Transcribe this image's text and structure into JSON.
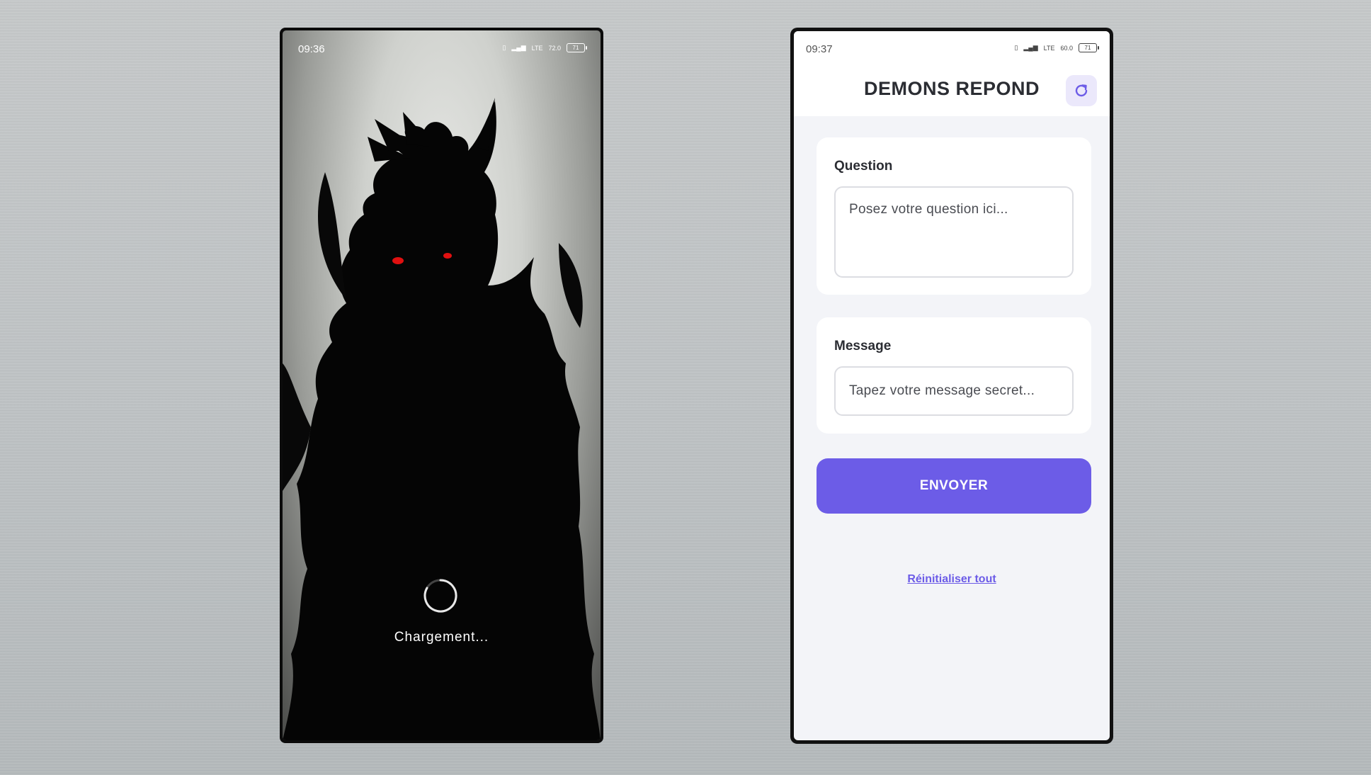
{
  "left_phone": {
    "status": {
      "time": "09:36",
      "signal": "LTE",
      "speed": "72.0",
      "battery": "71"
    },
    "loading_text": "Chargement..."
  },
  "right_phone": {
    "status": {
      "time": "09:37",
      "signal": "LTE",
      "speed": "60.0",
      "battery": "71"
    },
    "app_title": "DEMONS REPOND",
    "question": {
      "label": "Question",
      "placeholder": "Posez votre question ici..."
    },
    "message": {
      "label": "Message",
      "placeholder": "Tapez votre message secret..."
    },
    "send_label": "ENVOYER",
    "reset_label": "Réinitialiser tout"
  },
  "colors": {
    "accent": "#6c5ce7",
    "refresh_bg": "#ebe8fb",
    "eyes": "#e01010"
  }
}
